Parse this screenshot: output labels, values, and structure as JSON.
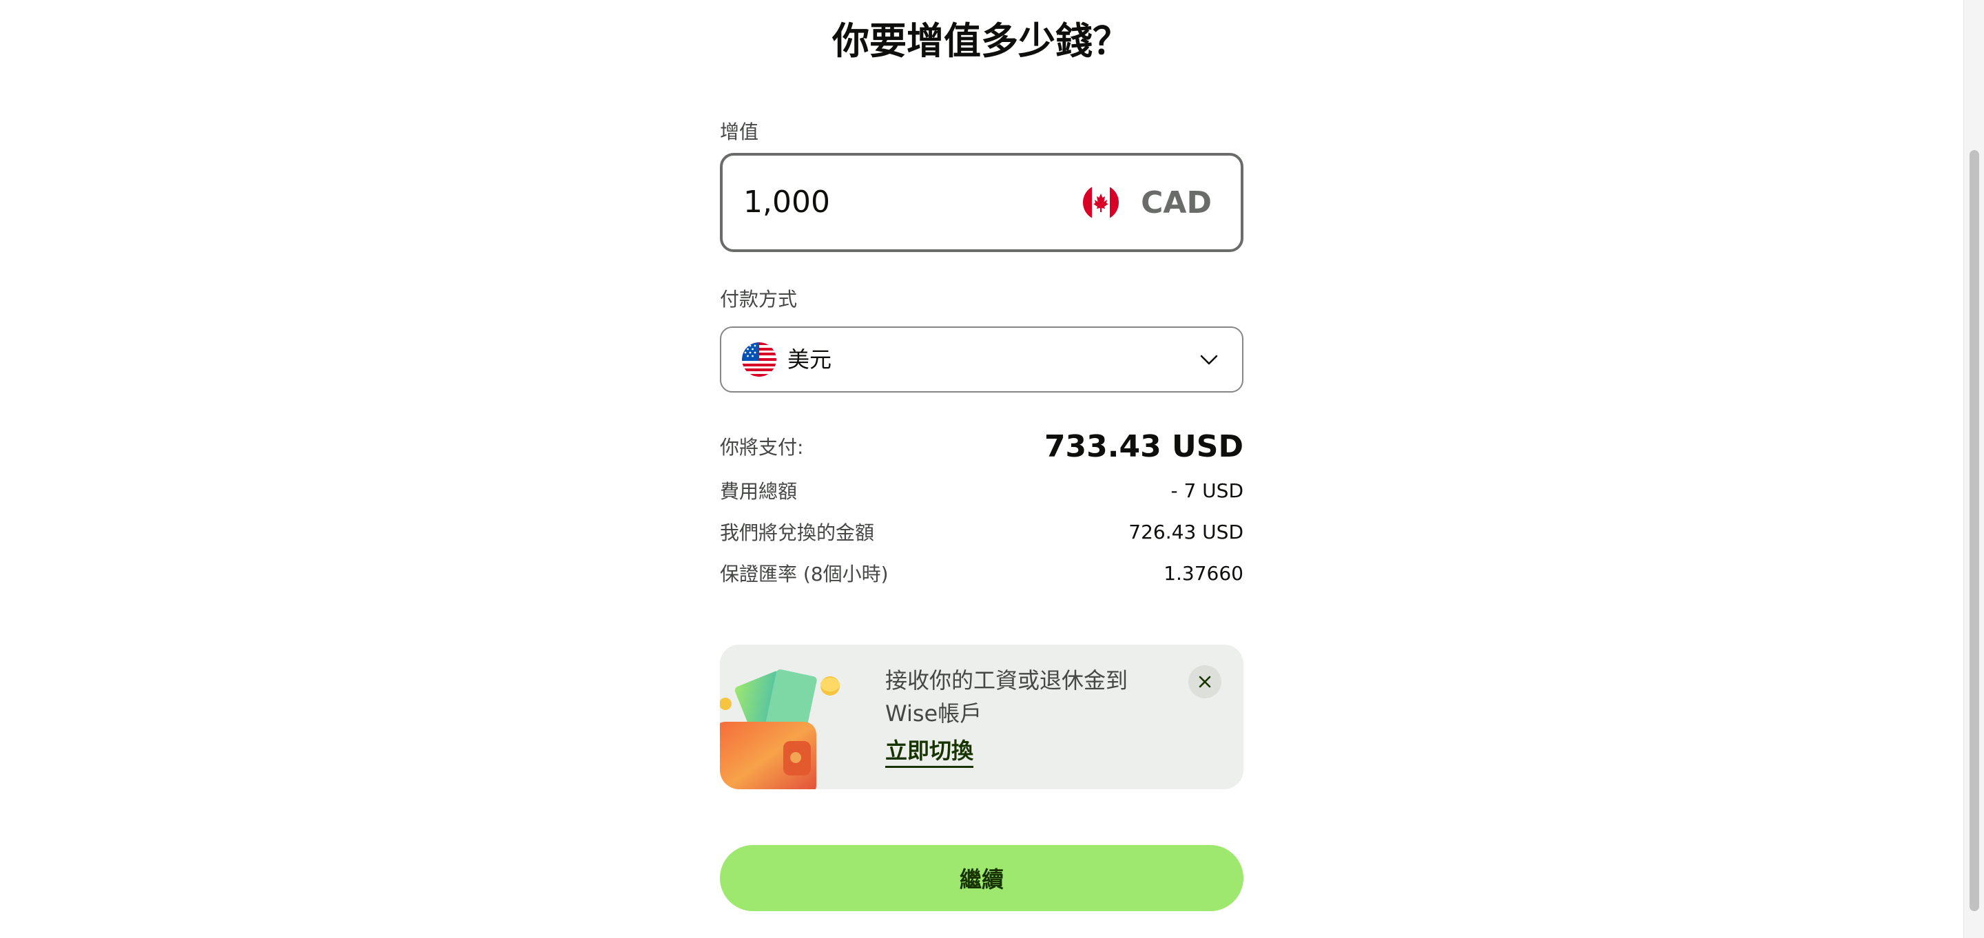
{
  "page": {
    "title": "你要增值多少錢？"
  },
  "amount": {
    "label": "增值",
    "value": "1,000",
    "currency_code": "CAD",
    "flag_icon": "canada-flag-icon"
  },
  "payment": {
    "label": "付款方式",
    "selected": "美元",
    "flag_icon": "us-flag-icon"
  },
  "summary": {
    "pay_label": "你將支付:",
    "pay_value": "733.43 USD",
    "fee_label": "費用總額",
    "fee_value": "- 7 USD",
    "convert_label": "我們將兌換的金額",
    "convert_value": "726.43 USD",
    "rate_label": "保證匯率 (8個小時)",
    "rate_value": "1.37660"
  },
  "promo": {
    "text": "接收你的工資或退休金到Wise帳戶",
    "link": "立即切換"
  },
  "actions": {
    "continue_label": "繼續"
  },
  "colors": {
    "accent_green": "#9fe870",
    "dark_green": "#163300",
    "promo_bg": "#edefec"
  }
}
